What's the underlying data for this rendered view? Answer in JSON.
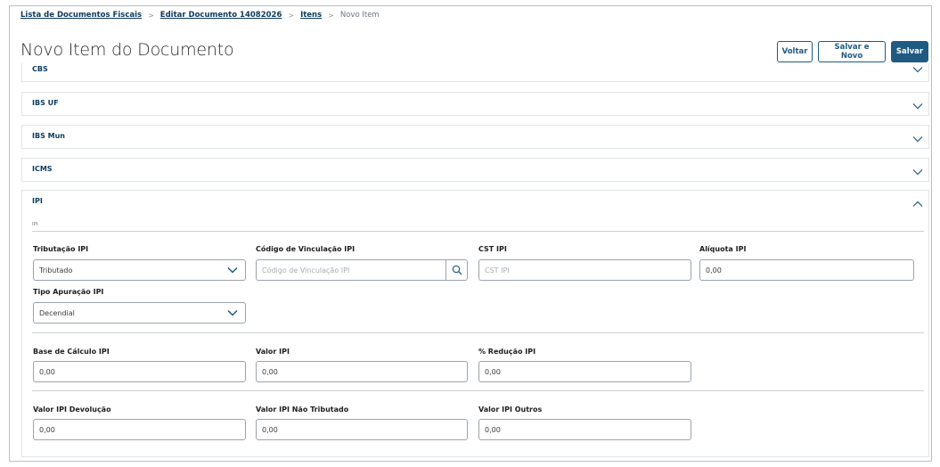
{
  "breadcrumb": {
    "items": [
      "Lista de Documentos Fiscais",
      "Editar Documento 14082026",
      "Itens"
    ],
    "current": "Novo Item",
    "separator": ">"
  },
  "page": {
    "title": "Novo Item do Documento"
  },
  "actions": {
    "back_label": "Voltar",
    "save_new_label": "Salvar e Novo",
    "save_label": "Salvar"
  },
  "panels": {
    "cbs": "CBS",
    "ibs_uf": "IBS UF",
    "ibs_mun": "IBS Mun",
    "icms": "ICMS"
  },
  "ipi": {
    "title": "IPI",
    "subtitle": "IPI",
    "tributacao": {
      "label": "Tributação IPI",
      "value": "Tributado"
    },
    "codigo_vinculacao": {
      "label": "Código de Vinculação IPI",
      "placeholder": "Código de Vinculação IPI"
    },
    "cst": {
      "label": "CST IPI",
      "placeholder": "CST IPI"
    },
    "aliquota": {
      "label": "Alíquota IPI",
      "value": "0,00"
    },
    "tipo_apuracao": {
      "label": "Tipo Apuração IPI",
      "value": "Decendial"
    },
    "base_calculo": {
      "label": "Base de Cálculo IPI",
      "value": "0,00"
    },
    "valor": {
      "label": "Valor IPI",
      "value": "0,00"
    },
    "reducao": {
      "label": "% Redução IPI",
      "value": "0,00"
    },
    "valor_devolucao": {
      "label": "Valor IPI Devolução",
      "value": "0,00"
    },
    "valor_nao_tributado": {
      "label": "Valor IPI Não Tributado",
      "value": "0,00"
    },
    "valor_outros": {
      "label": "Valor IPI Outros",
      "value": "0,00"
    }
  },
  "colors": {
    "primary": "#1e5a82",
    "link": "#0c3a5c",
    "border": "#9aa3ab"
  },
  "icons": [
    "chevron-down-icon",
    "chevron-up-icon",
    "search-icon"
  ]
}
